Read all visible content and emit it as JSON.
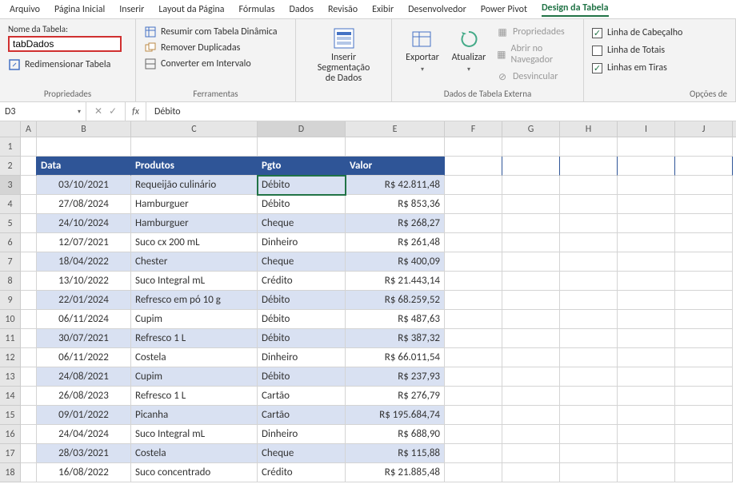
{
  "menubar": {
    "items": [
      "Arquivo",
      "Página Inicial",
      "Inserir",
      "Layout da Página",
      "Fórmulas",
      "Dados",
      "Revisão",
      "Exibir",
      "Desenvolvedor",
      "Power Pivot",
      "Design da Tabela"
    ],
    "active": "Design da Tabela"
  },
  "ribbon": {
    "group1": {
      "label": "Propriedades",
      "name_label": "Nome da Tabela:",
      "name_value": "tabDados",
      "resize": "Redimensionar Tabela"
    },
    "group2": {
      "label": "Ferramentas",
      "pivot": "Resumir com Tabela Dinâmica",
      "dedup": "Remover Duplicadas",
      "range": "Converter em Intervalo"
    },
    "group3": {
      "slicer": "Inserir Segmentação\nde Dados"
    },
    "group4": {
      "label": "Dados de Tabela Externa",
      "export": "Exportar",
      "refresh": "Atualizar",
      "props": "Propriedades",
      "browser": "Abrir no Navegador",
      "unlink": "Desvincular"
    },
    "group5": {
      "label": "Opções de",
      "header_row": "Linha de Cabeçalho",
      "total_row": "Linha de Totais",
      "banded_rows": "Linhas em Tiras"
    }
  },
  "formulabar": {
    "namebox": "D3",
    "fx": "fx",
    "value": "Débito"
  },
  "columns": [
    "A",
    "B",
    "C",
    "D",
    "E",
    "F",
    "G",
    "H",
    "I",
    "J"
  ],
  "table": {
    "headers": {
      "B": "Data",
      "C": "Produtos",
      "D": "Pgto",
      "E": "Valor"
    },
    "rows": [
      {
        "r": 3,
        "B": "03/10/2021",
        "C": "Requeijão culinário",
        "D": "Débito",
        "E": "R$ 42.811,48"
      },
      {
        "r": 4,
        "B": "27/08/2024",
        "C": "Hamburguer",
        "D": "Débito",
        "E": "R$ 853,36"
      },
      {
        "r": 5,
        "B": "24/10/2024",
        "C": "Hamburguer",
        "D": "Cheque",
        "E": "R$ 268,27"
      },
      {
        "r": 6,
        "B": "12/07/2021",
        "C": "Suco cx 200 mL",
        "D": "Dinheiro",
        "E": "R$ 261,48"
      },
      {
        "r": 7,
        "B": "18/04/2022",
        "C": "Chester",
        "D": "Cheque",
        "E": "R$ 400,09"
      },
      {
        "r": 8,
        "B": "13/10/2022",
        "C": "Suco Integral mL",
        "D": "Crédito",
        "E": "R$ 21.443,14"
      },
      {
        "r": 9,
        "B": "22/01/2024",
        "C": "Refresco em pó 10 g",
        "D": "Débito",
        "E": "R$ 68.259,52"
      },
      {
        "r": 10,
        "B": "06/11/2024",
        "C": "Cupim",
        "D": "Débito",
        "E": "R$ 487,63"
      },
      {
        "r": 11,
        "B": "30/07/2021",
        "C": "Refresco 1 L",
        "D": "Débito",
        "E": "R$ 387,32"
      },
      {
        "r": 12,
        "B": "06/11/2022",
        "C": "Costela",
        "D": "Dinheiro",
        "E": "R$ 66.011,54"
      },
      {
        "r": 13,
        "B": "24/08/2021",
        "C": "Cupim",
        "D": "Débito",
        "E": "R$ 237,93"
      },
      {
        "r": 14,
        "B": "26/08/2023",
        "C": "Refresco 1 L",
        "D": "Cartão",
        "E": "R$ 276,79"
      },
      {
        "r": 15,
        "B": "09/01/2022",
        "C": "Picanha",
        "D": "Cartão",
        "E": "R$ 195.684,74"
      },
      {
        "r": 16,
        "B": "24/04/2024",
        "C": "Suco Integral mL",
        "D": "Dinheiro",
        "E": "R$ 688,90"
      },
      {
        "r": 17,
        "B": "28/03/2021",
        "C": "Costela",
        "D": "Cheque",
        "E": "R$ 115,88"
      },
      {
        "r": 18,
        "B": "16/08/2022",
        "C": "Suco concentrado",
        "D": "Crédito",
        "E": "R$ 21.885,48"
      }
    ]
  },
  "symbols": {
    "check": "✓",
    "dropdown": "▾",
    "down_small": "▾",
    "x": "✕"
  }
}
